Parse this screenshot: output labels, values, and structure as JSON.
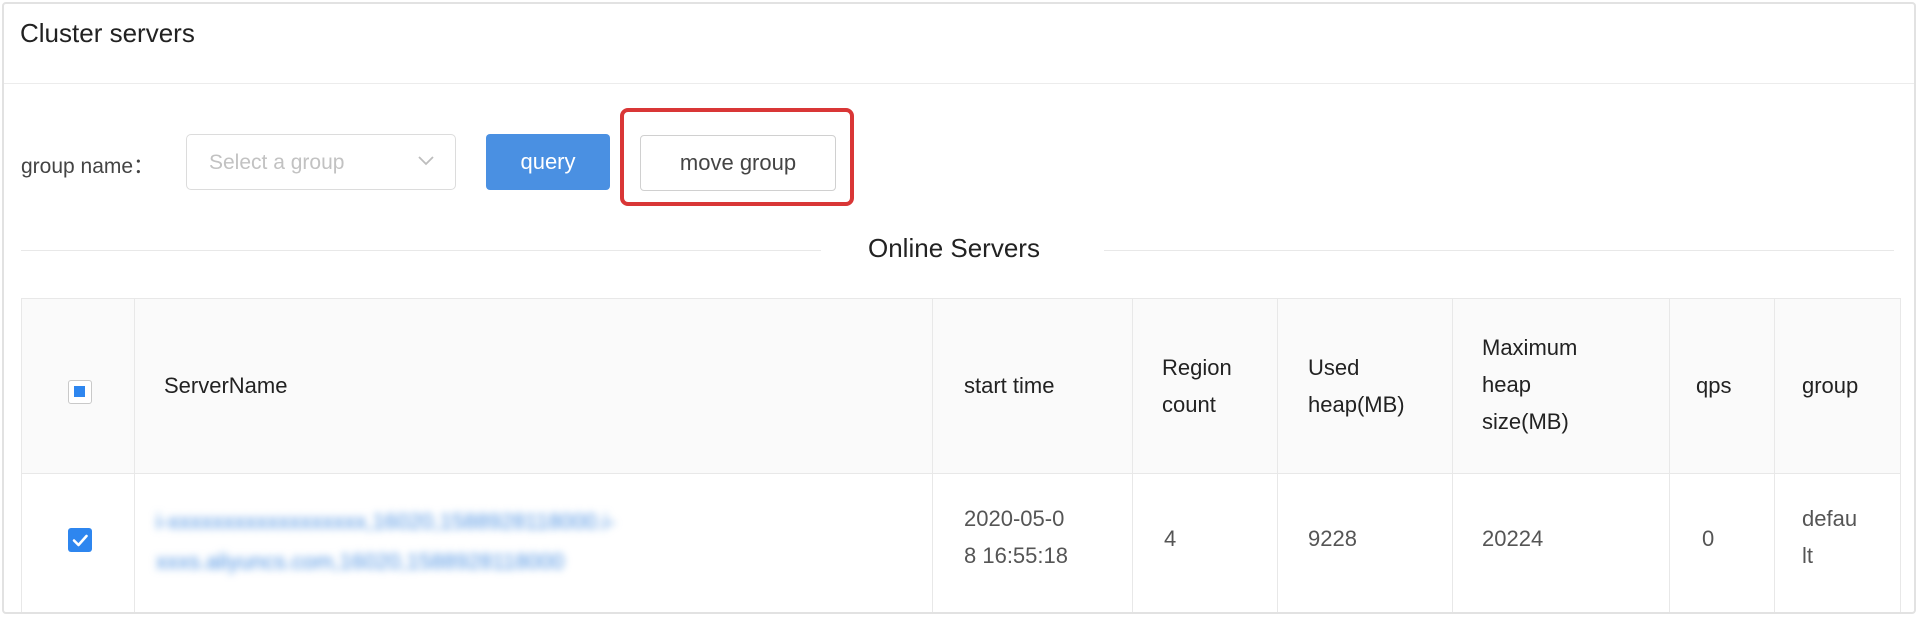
{
  "header": {
    "title": "Cluster servers"
  },
  "filter": {
    "label": "group name：",
    "placeholder": "Select a group",
    "query_label": "query",
    "move_group_label": "move group"
  },
  "divider": {
    "label": "Online Servers"
  },
  "table": {
    "columns": {
      "server_name": "ServerName",
      "start_time": "start time",
      "region_count": [
        "Region",
        "count"
      ],
      "used_heap": [
        "Used",
        "heap(MB)"
      ],
      "max_heap": [
        "Maximum",
        "heap",
        "size(MB)"
      ],
      "qps": "qps",
      "group": "group"
    },
    "rows": [
      {
        "selected": true,
        "server_name": [
          "i-xxxxxxxxxxxxxxxxxx,16020,1588928118000.i-",
          "xxxs.aliyuncs.com,16020,1588928118000"
        ],
        "start_time": [
          "2020-05-0",
          "8 16:55:18"
        ],
        "region_count": "4",
        "used_heap": "9228",
        "max_heap": "20224",
        "qps": "0",
        "group": [
          "defau",
          "lt"
        ]
      }
    ]
  },
  "colors": {
    "accent": "#4a90e2",
    "highlight": "#d93636"
  }
}
